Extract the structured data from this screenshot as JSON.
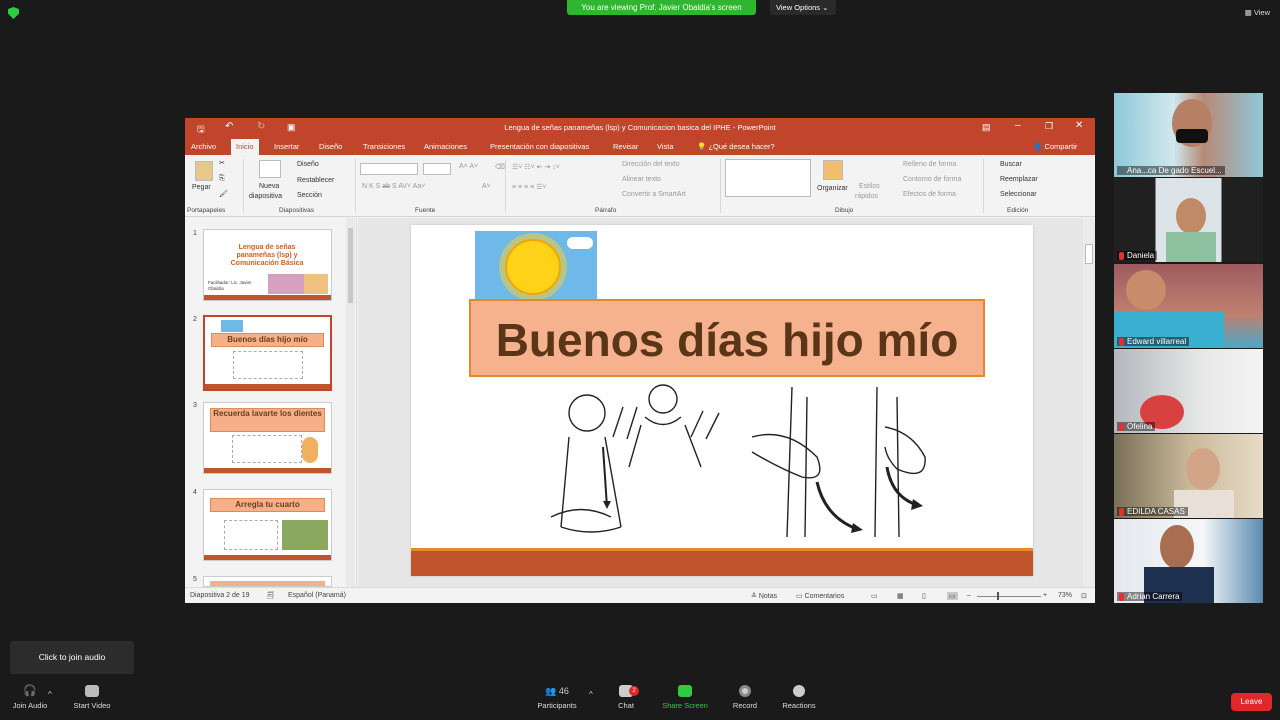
{
  "zoom": {
    "banner": "You are viewing Prof. Javier Obaldia's screen",
    "view_options": "View Options",
    "view": "View",
    "tooltip": "Click to join audio",
    "toolbar": {
      "join_audio": "Join Audio",
      "start_video": "Start Video",
      "participants": "Participants",
      "participants_count": "46",
      "chat": "Chat",
      "chat_badge": "2",
      "share_screen": "Share Screen",
      "record": "Record",
      "reactions": "Reactions",
      "leave": "Leave"
    },
    "participants": [
      {
        "name": "Ana...ca De gado Escuel..."
      },
      {
        "name": "Daniela"
      },
      {
        "name": "Edward villarreal"
      },
      {
        "name": "Ofelina"
      },
      {
        "name": "EDILDA CASAS"
      },
      {
        "name": "Adrian Carrera"
      }
    ]
  },
  "ppt": {
    "title": "Lengua de señas panameñas (lsp) y Comunicacion basica del IPHE - PowerPoint",
    "tabs": [
      "Archivo",
      "Inicio",
      "Insertar",
      "Diseño",
      "Transiciones",
      "Animaciones",
      "Presentación con diapositivas",
      "Revisar",
      "Vista",
      "¿Qué desea hacer?"
    ],
    "share": "Compartir",
    "ribbon": {
      "paste": "Pegar",
      "new_slide_1": "Nueva",
      "new_slide_2": "diapositiva",
      "layout": "Diseño",
      "reset": "Restablecer",
      "section": "Sección",
      "text_direction": "Dirección del texto",
      "align_text": "Alinear texto",
      "convert_smartart": "Convertir a SmartArt",
      "organize": "Organizar",
      "quick_styles_1": "Estilos",
      "quick_styles_2": "rápidos",
      "shape_fill": "Relleno de forma",
      "shape_outline": "Contorno de forma",
      "shape_effects": "Efectos de forma",
      "find": "Buscar",
      "replace": "Reemplazar",
      "select": "Seleccionar",
      "groups": [
        "Portapapeles",
        "Diapositivas",
        "Fuente",
        "Párrafo",
        "Dibujo",
        "Edición"
      ]
    },
    "thumbs": [
      {
        "num": "1",
        "title": "Lengua de señas panameñas (lsp) y Comunicación Básica",
        "sub": "Facilitador: Lic. Javier Obaldía"
      },
      {
        "num": "2",
        "title": "Buenos días hijo mío"
      },
      {
        "num": "3",
        "title": "Recuerda lavarte los dientes"
      },
      {
        "num": "4",
        "title": "Arregla tu cuarto"
      },
      {
        "num": "5",
        "title": ""
      }
    ],
    "slide_title": "Buenos días hijo mío",
    "status": {
      "slide_of": "Diapositiva 2 de 19",
      "language": "Español (Panamá)",
      "notes": "Notas",
      "comments": "Comentarios",
      "zoom": "73%"
    }
  }
}
